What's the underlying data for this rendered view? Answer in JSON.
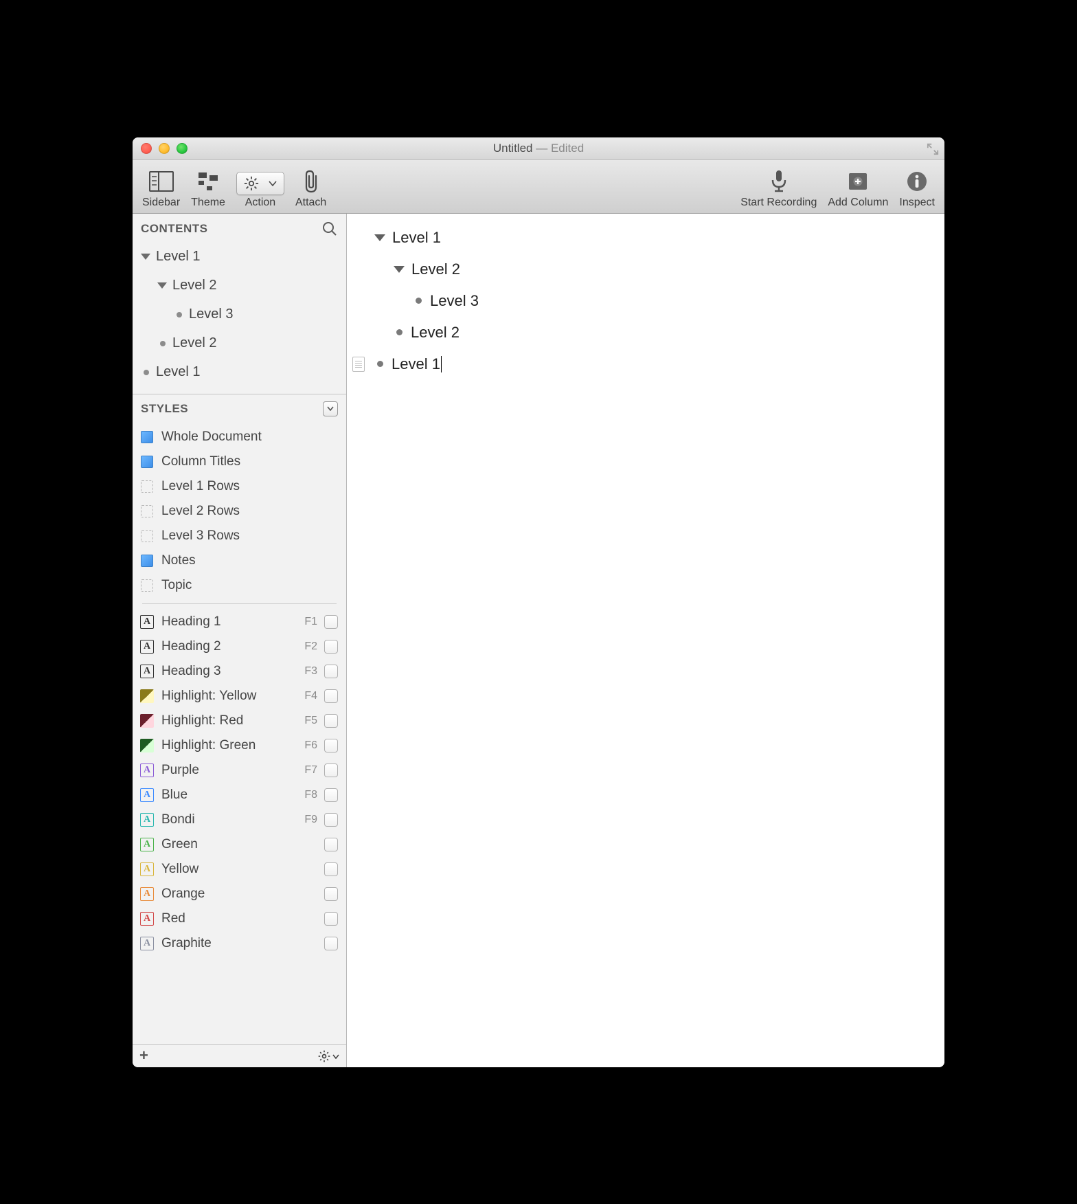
{
  "window": {
    "title": "Untitled",
    "edited_label": "Edited"
  },
  "toolbar": {
    "sidebar": "Sidebar",
    "theme": "Theme",
    "action": "Action",
    "attach": "Attach",
    "start_recording": "Start Recording",
    "add_column": "Add Column",
    "inspect": "Inspect"
  },
  "sidebar": {
    "contents_header": "CONTENTS",
    "styles_header": "STYLES",
    "contents": [
      {
        "label": "Level 1",
        "indent": 0,
        "type": "disclosure"
      },
      {
        "label": "Level 2",
        "indent": 1,
        "type": "disclosure"
      },
      {
        "label": "Level 3",
        "indent": 2,
        "type": "bullet"
      },
      {
        "label": "Level 2",
        "indent": 1,
        "type": "bullet"
      },
      {
        "label": "Level 1",
        "indent": 0,
        "type": "bullet"
      }
    ],
    "row": {
      "l1a": "Level 1",
      "l2a": "Level 2",
      "l3a": "Level 3",
      "l2b": "Level 2",
      "l1b": "Level 1"
    },
    "styles_structural": [
      {
        "label": "Whole Document",
        "icon": "blue"
      },
      {
        "label": "Column Titles",
        "icon": "blue"
      },
      {
        "label": "Level 1 Rows",
        "icon": "dashed"
      },
      {
        "label": "Level 2 Rows",
        "icon": "dashed"
      },
      {
        "label": "Level 3 Rows",
        "icon": "dashed"
      },
      {
        "label": "Notes",
        "icon": "blue"
      },
      {
        "label": "Topic",
        "icon": "dashed"
      }
    ],
    "ss": {
      "whole": "Whole Document",
      "coltitles": "Column Titles",
      "l1rows": "Level 1 Rows",
      "l2rows": "Level 2 Rows",
      "l3rows": "Level 3 Rows",
      "notes": "Notes",
      "topic": "Topic"
    },
    "styles_named": [
      {
        "label": "Heading 1",
        "key": "F1",
        "kind": "letter",
        "color": "#333"
      },
      {
        "label": "Heading 2",
        "key": "F2",
        "kind": "letter",
        "color": "#333"
      },
      {
        "label": "Heading 3",
        "key": "F3",
        "kind": "letter",
        "color": "#333"
      },
      {
        "label": "Highlight: Yellow",
        "key": "F4",
        "kind": "hl",
        "gradient": "linear-gradient(135deg,#8a7a1a 0 50%,#fff7c0 50% 100%)"
      },
      {
        "label": "Highlight: Red",
        "key": "F5",
        "kind": "hl",
        "gradient": "linear-gradient(135deg,#6b1f2b 0 50%,#ffd6de 50% 100%)"
      },
      {
        "label": "Highlight: Green",
        "key": "F6",
        "kind": "hl",
        "gradient": "linear-gradient(135deg,#1e5b22 0 50%,#d8ffd6 50% 100%)"
      },
      {
        "label": "Purple",
        "key": "F7",
        "kind": "letter",
        "color": "#8b5bd6"
      },
      {
        "label": "Blue",
        "key": "F8",
        "kind": "letter",
        "color": "#3d8bff"
      },
      {
        "label": "Bondi",
        "key": "F9",
        "kind": "letter",
        "color": "#2bb8b0"
      },
      {
        "label": "Green",
        "key": "",
        "kind": "letter",
        "color": "#4bb34b"
      },
      {
        "label": "Yellow",
        "key": "",
        "kind": "letter",
        "color": "#d9b53a"
      },
      {
        "label": "Orange",
        "key": "",
        "kind": "letter",
        "color": "#e88b3a"
      },
      {
        "label": "Red",
        "key": "",
        "kind": "letter",
        "color": "#d24a4a"
      },
      {
        "label": "Graphite",
        "key": "",
        "kind": "letter",
        "color": "#8a8fa0"
      }
    ],
    "sn": {
      "h1": "Heading 1",
      "h1k": "F1",
      "h2": "Heading 2",
      "h2k": "F2",
      "h3": "Heading 3",
      "h3k": "F3",
      "hy": "Highlight: Yellow",
      "hyk": "F4",
      "hr": "Highlight: Red",
      "hrk": "F5",
      "hg": "Highlight: Green",
      "hgk": "F6",
      "pu": "Purple",
      "puk": "F7",
      "bl": "Blue",
      "blk": "F8",
      "bo": "Bondi",
      "bok": "F9",
      "gr": "Green",
      "ye": "Yellow",
      "or": "Orange",
      "re": "Red",
      "gp": "Graphite"
    }
  },
  "outline": [
    {
      "label": "Level 1",
      "indent": 0,
      "type": "disclosure"
    },
    {
      "label": "Level 2",
      "indent": 1,
      "type": "disclosure"
    },
    {
      "label": "Level 3",
      "indent": 2,
      "type": "bullet"
    },
    {
      "label": "Level 2",
      "indent": 1,
      "type": "bullet"
    },
    {
      "label": "Level 1",
      "indent": 0,
      "type": "bullet",
      "cursor": true,
      "handle": true
    }
  ],
  "main": {
    "l1a": "Level 1",
    "l2a": "Level 2",
    "l3a": "Level 3",
    "l2b": "Level 2",
    "l1b": "Level 1"
  }
}
